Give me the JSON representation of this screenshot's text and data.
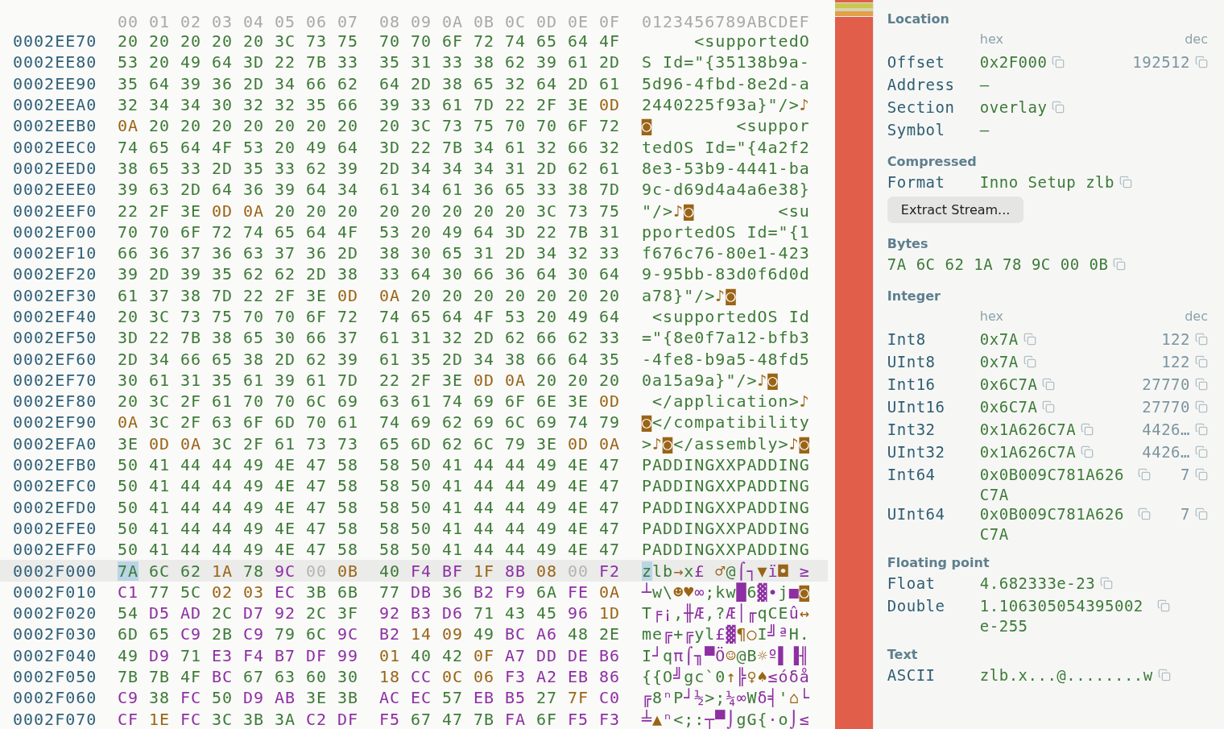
{
  "hex_view": {
    "column_headers": [
      "00",
      "01",
      "02",
      "03",
      "04",
      "05",
      "06",
      "07",
      "08",
      "09",
      "0A",
      "0B",
      "0C",
      "0D",
      "0E",
      "0F"
    ],
    "ascii_header": "0123456789ABCDEF",
    "rows": [
      {
        "offset": "0002EE70",
        "bytes": [
          "20",
          "20",
          "20",
          "20",
          "20",
          "3C",
          "73",
          "75",
          "70",
          "70",
          "6F",
          "72",
          "74",
          "65",
          "64",
          "4F"
        ],
        "ascii": "     <supportedO",
        "selected": false
      },
      {
        "offset": "0002EE80",
        "bytes": [
          "53",
          "20",
          "49",
          "64",
          "3D",
          "22",
          "7B",
          "33",
          "35",
          "31",
          "33",
          "38",
          "62",
          "39",
          "61",
          "2D"
        ],
        "ascii": "S Id=\"{35138b9a-",
        "selected": false
      },
      {
        "offset": "0002EE90",
        "bytes": [
          "35",
          "64",
          "39",
          "36",
          "2D",
          "34",
          "66",
          "62",
          "64",
          "2D",
          "38",
          "65",
          "32",
          "64",
          "2D",
          "61"
        ],
        "ascii": "5d96-4fbd-8e2d-a",
        "selected": false
      },
      {
        "offset": "0002EEA0",
        "bytes": [
          "32",
          "34",
          "34",
          "30",
          "32",
          "32",
          "35",
          "66",
          "39",
          "33",
          "61",
          "7D",
          "22",
          "2F",
          "3E",
          "0D"
        ],
        "ascii": "2440225f93a}\"/>♪",
        "selected": false
      },
      {
        "offset": "0002EEB0",
        "bytes": [
          "0A",
          "20",
          "20",
          "20",
          "20",
          "20",
          "20",
          "20",
          "20",
          "3C",
          "73",
          "75",
          "70",
          "70",
          "6F",
          "72"
        ],
        "ascii": "◙        <suppor",
        "selected": false
      },
      {
        "offset": "0002EEC0",
        "bytes": [
          "74",
          "65",
          "64",
          "4F",
          "53",
          "20",
          "49",
          "64",
          "3D",
          "22",
          "7B",
          "34",
          "61",
          "32",
          "66",
          "32"
        ],
        "ascii": "tedOS Id=\"{4a2f2",
        "selected": false
      },
      {
        "offset": "0002EED0",
        "bytes": [
          "38",
          "65",
          "33",
          "2D",
          "35",
          "33",
          "62",
          "39",
          "2D",
          "34",
          "34",
          "34",
          "31",
          "2D",
          "62",
          "61"
        ],
        "ascii": "8e3-53b9-4441-ba",
        "selected": false
      },
      {
        "offset": "0002EEE0",
        "bytes": [
          "39",
          "63",
          "2D",
          "64",
          "36",
          "39",
          "64",
          "34",
          "61",
          "34",
          "61",
          "36",
          "65",
          "33",
          "38",
          "7D"
        ],
        "ascii": "9c-d69d4a4a6e38}",
        "selected": false
      },
      {
        "offset": "0002EEF0",
        "bytes": [
          "22",
          "2F",
          "3E",
          "0D",
          "0A",
          "20",
          "20",
          "20",
          "20",
          "20",
          "20",
          "20",
          "20",
          "3C",
          "73",
          "75"
        ],
        "ascii": "\"/>♪◙        <su",
        "selected": false
      },
      {
        "offset": "0002EF00",
        "bytes": [
          "70",
          "70",
          "6F",
          "72",
          "74",
          "65",
          "64",
          "4F",
          "53",
          "20",
          "49",
          "64",
          "3D",
          "22",
          "7B",
          "31"
        ],
        "ascii": "pportedOS Id=\"{1",
        "selected": false
      },
      {
        "offset": "0002EF10",
        "bytes": [
          "66",
          "36",
          "37",
          "36",
          "63",
          "37",
          "36",
          "2D",
          "38",
          "30",
          "65",
          "31",
          "2D",
          "34",
          "32",
          "33"
        ],
        "ascii": "f676c76-80e1-423",
        "selected": false
      },
      {
        "offset": "0002EF20",
        "bytes": [
          "39",
          "2D",
          "39",
          "35",
          "62",
          "62",
          "2D",
          "38",
          "33",
          "64",
          "30",
          "66",
          "36",
          "64",
          "30",
          "64"
        ],
        "ascii": "9-95bb-83d0f6d0d",
        "selected": false
      },
      {
        "offset": "0002EF30",
        "bytes": [
          "61",
          "37",
          "38",
          "7D",
          "22",
          "2F",
          "3E",
          "0D",
          "0A",
          "20",
          "20",
          "20",
          "20",
          "20",
          "20",
          "20"
        ],
        "ascii": "a78}\"/>♪◙",
        "selected": false
      },
      {
        "offset": "0002EF40",
        "bytes": [
          "20",
          "3C",
          "73",
          "75",
          "70",
          "70",
          "6F",
          "72",
          "74",
          "65",
          "64",
          "4F",
          "53",
          "20",
          "49",
          "64"
        ],
        "ascii": " <supportedOS Id",
        "selected": false
      },
      {
        "offset": "0002EF50",
        "bytes": [
          "3D",
          "22",
          "7B",
          "38",
          "65",
          "30",
          "66",
          "37",
          "61",
          "31",
          "32",
          "2D",
          "62",
          "66",
          "62",
          "33"
        ],
        "ascii": "=\"{8e0f7a12-bfb3",
        "selected": false
      },
      {
        "offset": "0002EF60",
        "bytes": [
          "2D",
          "34",
          "66",
          "65",
          "38",
          "2D",
          "62",
          "39",
          "61",
          "35",
          "2D",
          "34",
          "38",
          "66",
          "64",
          "35"
        ],
        "ascii": "-4fe8-b9a5-48fd5",
        "selected": false
      },
      {
        "offset": "0002EF70",
        "bytes": [
          "30",
          "61",
          "31",
          "35",
          "61",
          "39",
          "61",
          "7D",
          "22",
          "2F",
          "3E",
          "0D",
          "0A",
          "20",
          "20",
          "20"
        ],
        "ascii": "0a15a9a}\"/>♪◙",
        "selected": false
      },
      {
        "offset": "0002EF80",
        "bytes": [
          "20",
          "3C",
          "2F",
          "61",
          "70",
          "70",
          "6C",
          "69",
          "63",
          "61",
          "74",
          "69",
          "6F",
          "6E",
          "3E",
          "0D"
        ],
        "ascii": " </application>♪",
        "selected": false
      },
      {
        "offset": "0002EF90",
        "bytes": [
          "0A",
          "3C",
          "2F",
          "63",
          "6F",
          "6D",
          "70",
          "61",
          "74",
          "69",
          "62",
          "69",
          "6C",
          "69",
          "74",
          "79"
        ],
        "ascii": "◙</compatibility",
        "selected": false
      },
      {
        "offset": "0002EFA0",
        "bytes": [
          "3E",
          "0D",
          "0A",
          "3C",
          "2F",
          "61",
          "73",
          "73",
          "65",
          "6D",
          "62",
          "6C",
          "79",
          "3E",
          "0D",
          "0A"
        ],
        "ascii": ">♪◙</assembly>♪◙",
        "selected": false
      },
      {
        "offset": "0002EFB0",
        "bytes": [
          "50",
          "41",
          "44",
          "44",
          "49",
          "4E",
          "47",
          "58",
          "58",
          "50",
          "41",
          "44",
          "44",
          "49",
          "4E",
          "47"
        ],
        "ascii": "PADDINGXXPADDING",
        "selected": false
      },
      {
        "offset": "0002EFC0",
        "bytes": [
          "50",
          "41",
          "44",
          "44",
          "49",
          "4E",
          "47",
          "58",
          "58",
          "50",
          "41",
          "44",
          "44",
          "49",
          "4E",
          "47"
        ],
        "ascii": "PADDINGXXPADDING",
        "selected": false
      },
      {
        "offset": "0002EFD0",
        "bytes": [
          "50",
          "41",
          "44",
          "44",
          "49",
          "4E",
          "47",
          "58",
          "58",
          "50",
          "41",
          "44",
          "44",
          "49",
          "4E",
          "47"
        ],
        "ascii": "PADDINGXXPADDING",
        "selected": false
      },
      {
        "offset": "0002EFE0",
        "bytes": [
          "50",
          "41",
          "44",
          "44",
          "49",
          "4E",
          "47",
          "58",
          "58",
          "50",
          "41",
          "44",
          "44",
          "49",
          "4E",
          "47"
        ],
        "ascii": "PADDINGXXPADDING",
        "selected": false
      },
      {
        "offset": "0002EFF0",
        "bytes": [
          "50",
          "41",
          "44",
          "44",
          "49",
          "4E",
          "47",
          "58",
          "58",
          "50",
          "41",
          "44",
          "44",
          "49",
          "4E",
          "47"
        ],
        "ascii": "PADDINGXXPADDING",
        "selected": false
      },
      {
        "offset": "0002F000",
        "bytes": [
          "7A",
          "6C",
          "62",
          "1A",
          "78",
          "9C",
          "00",
          "0B",
          "40",
          "F4",
          "BF",
          "1F",
          "8B",
          "08",
          "00",
          "F2"
        ],
        "ascii": "zlb→x£ ♂@⌠┐▼ï◘ ≥",
        "selected": true
      },
      {
        "offset": "0002F010",
        "bytes": [
          "C1",
          "77",
          "5C",
          "02",
          "03",
          "EC",
          "3B",
          "6B",
          "77",
          "DB",
          "36",
          "B2",
          "F9",
          "6A",
          "FE",
          "0A"
        ],
        "ascii": "┴w\\☻♥∞;kw█6▓∙j■◙",
        "selected": false
      },
      {
        "offset": "0002F020",
        "bytes": [
          "54",
          "D5",
          "AD",
          "2C",
          "D7",
          "92",
          "2C",
          "3F",
          "92",
          "B3",
          "D6",
          "71",
          "43",
          "45",
          "96",
          "1D"
        ],
        "ascii": "T╒¡,╫Æ,?Æ│╓qCEû↔",
        "selected": false
      },
      {
        "offset": "0002F030",
        "bytes": [
          "6D",
          "65",
          "C9",
          "2B",
          "C9",
          "79",
          "6C",
          "9C",
          "B2",
          "14",
          "09",
          "49",
          "BC",
          "A6",
          "48",
          "2E"
        ],
        "ascii": "me╔+╔yl£▓¶○I╝ªH.",
        "selected": false
      },
      {
        "offset": "0002F040",
        "bytes": [
          "49",
          "D9",
          "71",
          "E3",
          "F4",
          "B7",
          "DF",
          "99",
          "01",
          "40",
          "42",
          "0F",
          "A7",
          "DD",
          "DE",
          "B6"
        ],
        "ascii": "I┘qπ⌠╖▀Ö☺@B☼º▌▐╢",
        "selected": false
      },
      {
        "offset": "0002F050",
        "bytes": [
          "7B",
          "7B",
          "4F",
          "BC",
          "67",
          "63",
          "60",
          "30",
          "18",
          "CC",
          "0C",
          "06",
          "F3",
          "A2",
          "EB",
          "86"
        ],
        "ascii": "{{O╝gc`0↑╠♀♠≤óδå",
        "selected": false
      },
      {
        "offset": "0002F060",
        "bytes": [
          "C9",
          "38",
          "FC",
          "50",
          "D9",
          "AB",
          "3E",
          "3B",
          "AC",
          "EC",
          "57",
          "EB",
          "B5",
          "27",
          "7F",
          "C0"
        ],
        "ascii": "╔8ⁿP┘½>;¼∞Wδ╡'⌂└",
        "selected": false
      },
      {
        "offset": "0002F070",
        "bytes": [
          "CF",
          "1E",
          "FC",
          "3C",
          "3B",
          "3A",
          "C2",
          "DF",
          "F5",
          "67",
          "47",
          "7B",
          "FA",
          "6F",
          "F5",
          "F3"
        ],
        "ascii": "╧▲ⁿ<;:┬▀⌡gG{·o⌡≤",
        "selected": false
      }
    ]
  },
  "inspector": {
    "sections": [
      {
        "kind": "location",
        "title": "Location",
        "columns": [
          "hex",
          "dec"
        ],
        "rows": [
          {
            "label": "Offset",
            "value": "0x2F000",
            "value_copy": true,
            "dec": "192512",
            "dec_copy": true
          },
          {
            "label": "Address",
            "value": "—"
          },
          {
            "label": "Section",
            "value": "overlay",
            "value_copy": true
          },
          {
            "label": "Symbol",
            "value": "—"
          }
        ]
      },
      {
        "kind": "compressed",
        "title": "Compressed",
        "rows": [
          {
            "label": "Format",
            "value": "Inno Setup zlb",
            "value_copy": true
          }
        ],
        "button": "Extract Stream..."
      },
      {
        "kind": "bytes",
        "title": "Bytes",
        "rows": [
          {
            "value": "7A 6C 62 1A 78 9C 00 0B",
            "value_copy": true
          }
        ]
      },
      {
        "kind": "integer",
        "title": "Integer",
        "columns": [
          "hex",
          "dec"
        ],
        "rows": [
          {
            "label": "Int8",
            "value": "0x7A",
            "value_copy": true,
            "dec": "122",
            "dec_copy": true
          },
          {
            "label": "UInt8",
            "value": "0x7A",
            "value_copy": true,
            "dec": "122",
            "dec_copy": true
          },
          {
            "label": "Int16",
            "value": "0x6C7A",
            "value_copy": true,
            "dec": "27770",
            "dec_copy": true
          },
          {
            "label": "UInt16",
            "value": "0x6C7A",
            "value_copy": true,
            "dec": "27770",
            "dec_copy": true
          },
          {
            "label": "Int32",
            "value": "0x1A626C7A",
            "value_copy": true,
            "dec": "4426…",
            "dec_copy": true
          },
          {
            "label": "UInt32",
            "value": "0x1A626C7A",
            "value_copy": true,
            "dec": "4426…",
            "dec_copy": true
          },
          {
            "label": "Int64",
            "value": "0x0B009C781A626C7A",
            "value_copy": true,
            "dec": "7",
            "dec_copy": true
          },
          {
            "label": "UInt64",
            "value": "0x0B009C781A626C7A",
            "value_copy": true,
            "dec": "7",
            "dec_copy": true
          }
        ]
      },
      {
        "kind": "float",
        "title": "Floating point",
        "rows": [
          {
            "label": "Float",
            "value": "4.682333e-23",
            "value_copy": true
          },
          {
            "label": "Double",
            "value": "1.106305054395002e-255",
            "value_copy": true
          }
        ]
      },
      {
        "kind": "text",
        "title": "Text",
        "rows": [
          {
            "label": "ASCII",
            "value": "zlb.x...@........w",
            "value_copy": true
          }
        ]
      }
    ]
  }
}
